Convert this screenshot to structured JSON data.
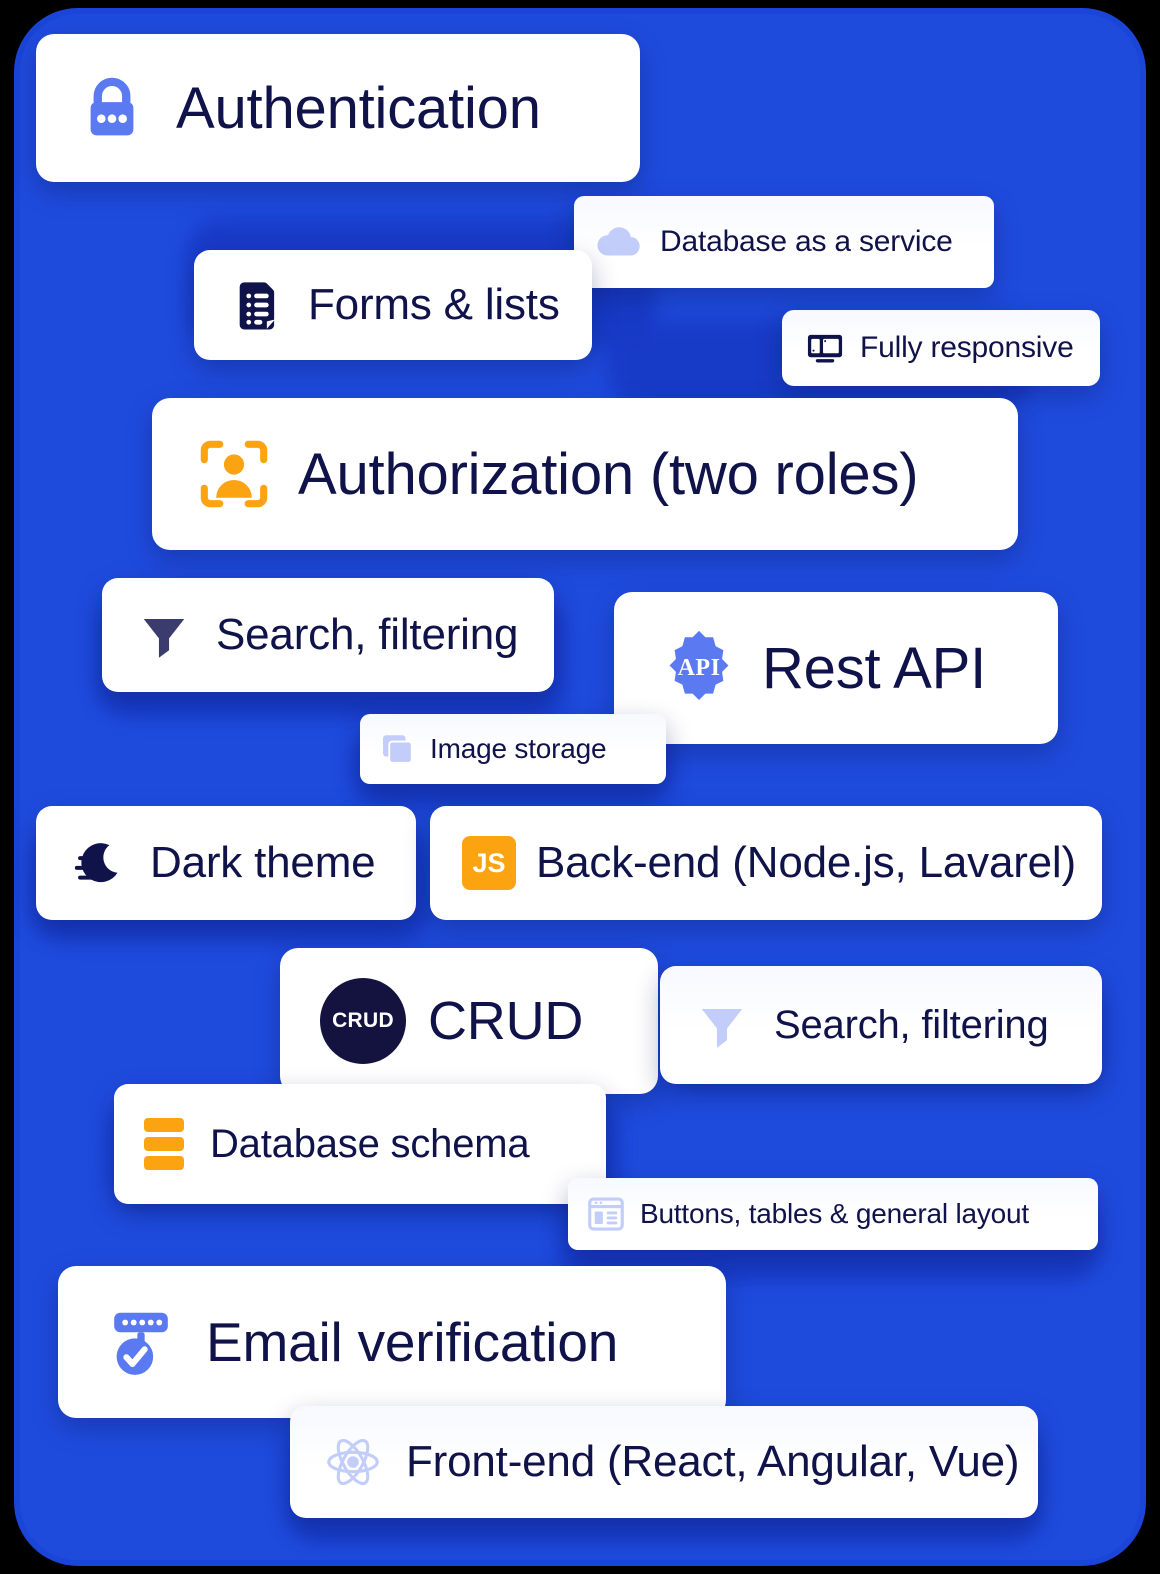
{
  "theme": {
    "background": "#000000",
    "panel_blue": "#1f4bdd",
    "panel_blue_shadow": "#1739c4",
    "card_white": "#ffffff",
    "text_navy": "#10124a",
    "accent_orange": "#fca311",
    "accent_periwinkle": "#5b79f0",
    "accent_lavender": "#c3cdfa"
  },
  "cards": [
    {
      "id": "authentication",
      "label": "Authentication",
      "icon": "lock-icon",
      "icon_color": "#5b79f0"
    },
    {
      "id": "database-as-a-service",
      "label": "Database as a service",
      "icon": "cloud-icon",
      "icon_color": "#c3cdfa"
    },
    {
      "id": "forms-lists",
      "label": "Forms & lists",
      "icon": "document-list-icon",
      "icon_color": "#10124a"
    },
    {
      "id": "fully-responsive",
      "label": "Fully responsive",
      "icon": "monitor-icon",
      "icon_color": "#10124a"
    },
    {
      "id": "authorization",
      "label": "Authorization (two roles)",
      "icon": "user-scan-icon",
      "icon_color": "#fca311"
    },
    {
      "id": "search-filtering-1",
      "label": "Search, filtering",
      "icon": "funnel-icon",
      "icon_color": "#3b3b6d"
    },
    {
      "id": "rest-api",
      "label": "Rest API",
      "icon": "api-gear-icon",
      "icon_color": "#5b79f0",
      "icon_text": "API"
    },
    {
      "id": "image-storage",
      "label": "Image storage",
      "icon": "images-icon",
      "icon_color": "#c3cdfa"
    },
    {
      "id": "dark-theme",
      "label": "Dark theme",
      "icon": "moon-icon",
      "icon_color": "#10124a"
    },
    {
      "id": "back-end",
      "label": "Back-end (Node.js, Lavarel)",
      "icon": "js-badge-icon",
      "icon_color": "#fca311",
      "icon_text": "JS"
    },
    {
      "id": "crud",
      "label": "CRUD",
      "icon": "crud-circle-icon",
      "icon_color": "#14123f",
      "icon_text": "CRUD"
    },
    {
      "id": "search-filtering-2",
      "label": "Search, filtering",
      "icon": "funnel-icon",
      "icon_color": "#c3cdfa"
    },
    {
      "id": "database-schema",
      "label": "Database schema",
      "icon": "db-stack-icon",
      "icon_color": "#fca311"
    },
    {
      "id": "buttons-tables",
      "label": "Buttons, tables & general layout",
      "icon": "layout-panel-icon",
      "icon_color": "#c3cdfa"
    },
    {
      "id": "email-verification",
      "label": "Email verification",
      "icon": "verified-field-icon",
      "icon_color": "#5b79f0"
    },
    {
      "id": "front-end",
      "label": "Front-end (React, Angular, Vue)",
      "icon": "react-atom-icon",
      "icon_color": "#c3cdfa"
    }
  ]
}
